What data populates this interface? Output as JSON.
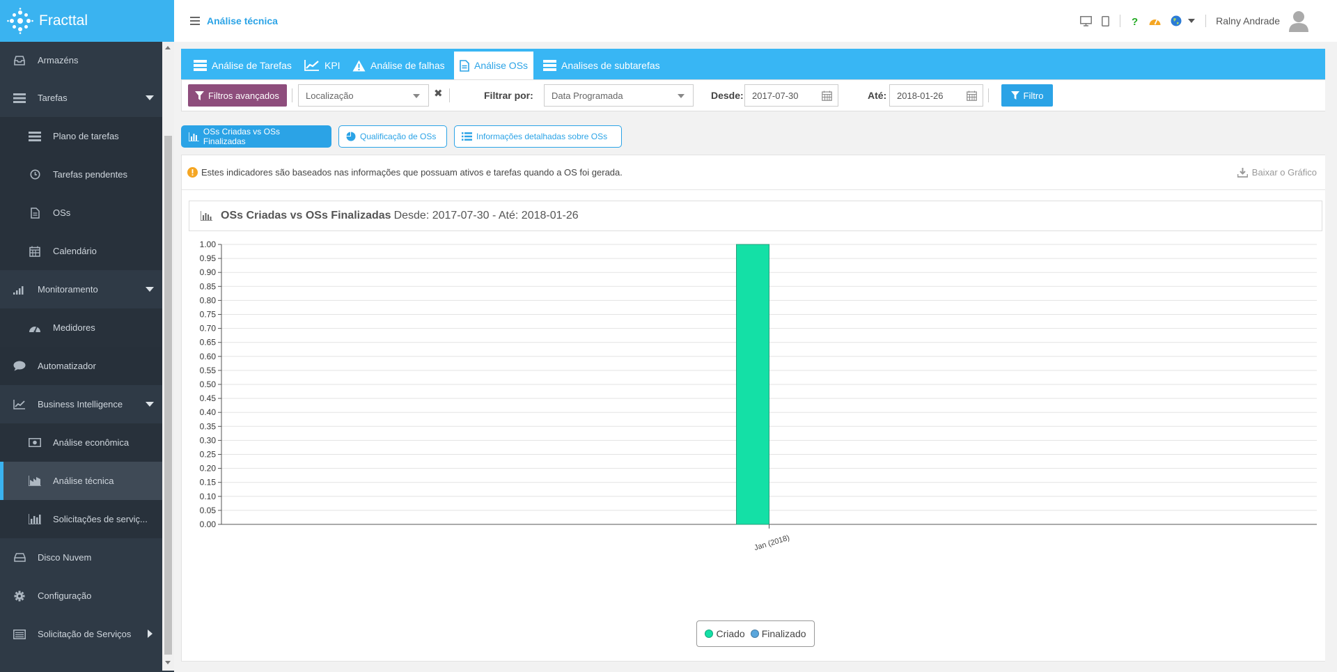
{
  "app": {
    "name": "Fracttal",
    "page_title": "Análise técnica"
  },
  "header": {
    "user_name": "Ralny Andrade"
  },
  "sidebar": {
    "items": [
      {
        "label": "Armazéns"
      },
      {
        "label": "Tarefas"
      },
      {
        "label": "Plano de tarefas"
      },
      {
        "label": "Tarefas pendentes"
      },
      {
        "label": "OSs"
      },
      {
        "label": "Calendário"
      },
      {
        "label": "Monitoramento"
      },
      {
        "label": "Medidores"
      },
      {
        "label": "Automatizador"
      },
      {
        "label": "Business Intelligence"
      },
      {
        "label": "Análise econômica"
      },
      {
        "label": "Análise técnica"
      },
      {
        "label": "Solicitações de serviç..."
      },
      {
        "label": "Disco Nuvem"
      },
      {
        "label": "Configuração"
      },
      {
        "label": "Solicitação de Serviços"
      }
    ]
  },
  "tabs": [
    {
      "label": "Análise de Tarefas"
    },
    {
      "label": "KPI"
    },
    {
      "label": "Análise de falhas"
    },
    {
      "label": "Análise OSs"
    },
    {
      "label": "Analises de subtarefas"
    }
  ],
  "filters": {
    "advanced_label": "Filtros avançados",
    "location_placeholder": "Localização",
    "filter_by_label": "Filtrar por:",
    "filter_by_value": "Data Programada",
    "from_label": "Desde:",
    "from_value": "2017-07-30",
    "to_label": "Até:",
    "to_value": "2018-01-26",
    "filter_button": "Filtro"
  },
  "subtabs": [
    {
      "label": "OSs Criadas vs OSs Finalizadas"
    },
    {
      "label": "Qualificação de OSs"
    },
    {
      "label": "Informações detalhadas sobre OSs"
    }
  ],
  "info": {
    "message": "Estes indicadores são baseados nas informações que possuam ativos e tarefas quando a OS foi gerada.",
    "download_label": "Baixar o Gráfico"
  },
  "chart_header": {
    "title": "OSs Criadas vs OSs Finalizadas",
    "subtitle": "Desde: 2017-07-30 - Até: 2018-01-26"
  },
  "colors": {
    "accent": "#38b6f4",
    "sidebar": "#2f3a46",
    "criado": "#14e0a6",
    "finalizado": "#5aa6dc",
    "advanced_btn": "#8e4d7c"
  },
  "chart_data": {
    "type": "bar",
    "categories": [
      "Jan (2018)"
    ],
    "series": [
      {
        "name": "Criado",
        "values": [
          1
        ]
      },
      {
        "name": "Finalizado",
        "values": [
          0
        ]
      }
    ],
    "ylim": [
      0,
      1
    ],
    "yticks": [
      "0.00",
      "0.05",
      "0.10",
      "0.15",
      "0.20",
      "0.25",
      "0.30",
      "0.35",
      "0.40",
      "0.45",
      "0.50",
      "0.55",
      "0.60",
      "0.65",
      "0.70",
      "0.75",
      "0.80",
      "0.85",
      "0.90",
      "0.95",
      "1.00"
    ],
    "grid": true,
    "legend": "bottom-center"
  }
}
